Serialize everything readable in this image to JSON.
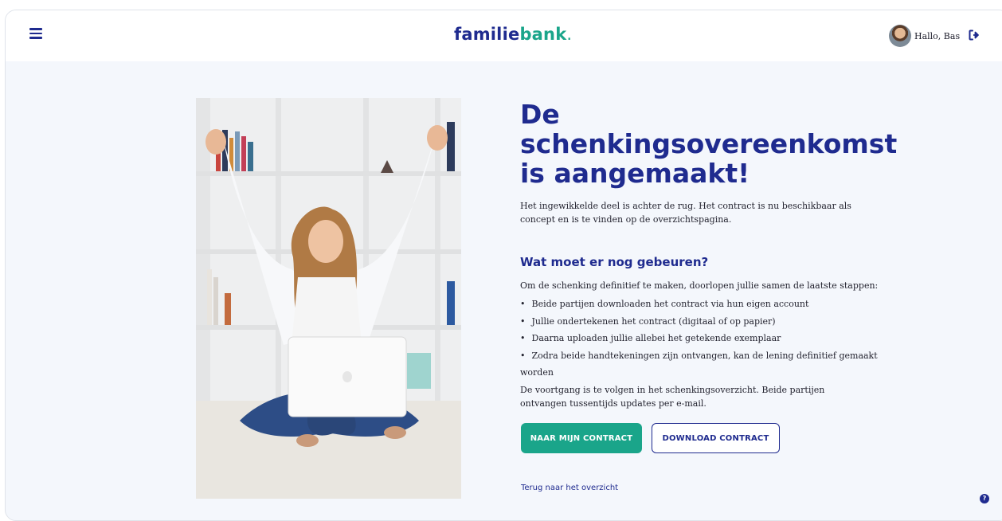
{
  "header": {
    "logo_part1": "familie",
    "logo_part2": "bank",
    "logo_dot": ".",
    "greeting": "Hallo, Bas",
    "menu_icon": "hamburger-icon",
    "logout_icon": "sign-out-icon"
  },
  "main": {
    "title": "De schenkingsovereenkomst is aangemaakt!",
    "intro": "Het ingewikkelde deel is achter de rug. Het contract is nu beschikbaar als concept en is te vinden op de overzichtspagina.",
    "subtitle": "Wat moet er nog gebeuren?",
    "steps_intro": "Om de schenking definitief te maken, doorlopen jullie samen de laatste stappen:",
    "steps": [
      "Beide partijen downloaden het contract via hun eigen account",
      "Jullie ondertekenen het contract (digitaal of op papier)",
      "Daarna uploaden jullie allebei het getekende exemplaar",
      "Zodra beide handtekeningen zijn ontvangen, kan de lening definitief gemaakt worden"
    ],
    "progress_text": "De voortgang is te volgen in het schenkingsoverzicht. Beide partijen ontvangen tussentijds updates per e-mail.",
    "primary_button": "NAAR MIJN CONTRACT",
    "secondary_button": "DOWNLOAD CONTRACT",
    "back_link": "Terug naar het overzicht"
  },
  "help_label": "?",
  "colors": {
    "brand_navy": "#1f2b8f",
    "brand_green": "#1aa58a",
    "background": "#f4f7fc"
  }
}
